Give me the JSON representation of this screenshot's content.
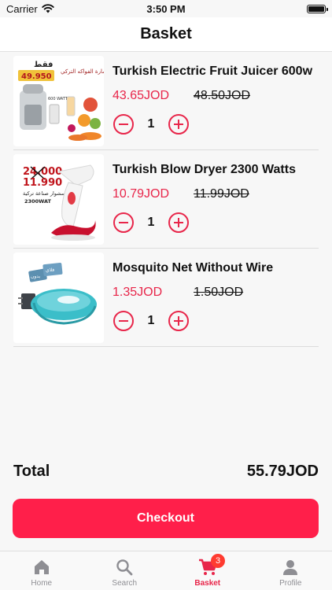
{
  "status_bar": {
    "carrier": "Carrier",
    "time": "3:50 PM"
  },
  "nav": {
    "title": "Basket"
  },
  "items": [
    {
      "name": "Turkish Electric Fruit Juicer 600w",
      "price": "43.65JOD",
      "old_price": "48.50JOD",
      "quantity": "1",
      "image_text": {
        "label": "فقط",
        "price": "49.950",
        "caption": "عصارة الفواكه التركي",
        "watt": "600 WATT"
      }
    },
    {
      "name": "Turkish Blow Dryer 2300 Watts",
      "price": "10.79JOD",
      "old_price": "11.99JOD",
      "quantity": "1",
      "image_text": {
        "old": "24.000",
        "new": "11.990",
        "caption": "سشوار صناعة تركية",
        "watt": "2300WAT"
      }
    },
    {
      "name": "Mosquito Net Without Wire",
      "price": "1.35JOD",
      "old_price": "1.50JOD",
      "quantity": "1",
      "image_text": {
        "tab1": "بدون",
        "tab2": "فلاي"
      }
    }
  ],
  "total": {
    "label": "Total",
    "amount": "55.79JOD"
  },
  "checkout": {
    "label": "Checkout"
  },
  "tabs": [
    {
      "label": "Home",
      "icon": "home-icon"
    },
    {
      "label": "Search",
      "icon": "search-icon"
    },
    {
      "label": "Basket",
      "icon": "cart-icon",
      "badge": "3"
    },
    {
      "label": "Profile",
      "icon": "profile-icon"
    }
  ],
  "colors": {
    "accent": "#e8264a",
    "checkout": "#ff1f4a",
    "badge": "#ff3b30",
    "inactive": "#8e8e93"
  }
}
